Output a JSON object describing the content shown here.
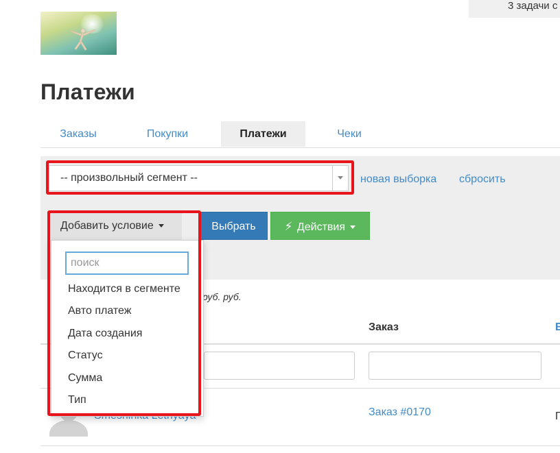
{
  "header": {
    "tasks_text": "3 задачи с"
  },
  "page": {
    "title": "Платежи"
  },
  "tabs": [
    {
      "label": "Заказы",
      "active": false
    },
    {
      "label": "Покупки",
      "active": false
    },
    {
      "label": "Платежи",
      "active": true
    },
    {
      "label": "Чеки",
      "active": false
    }
  ],
  "filter": {
    "segment_value": "-- произвольный сегмент --",
    "new_selection": "новая выборка",
    "reset": "сбросить",
    "add_condition": "Добавить условие",
    "choose": "Выбрать",
    "actions": "Действия"
  },
  "dropdown": {
    "search_placeholder": "поиск",
    "items": [
      "Находится в сегменте",
      "Авто платеж",
      "Дата создания",
      "Статус",
      "Сумма",
      "Тип"
    ]
  },
  "summary": {
    "text": "руб. руб."
  },
  "table": {
    "headers": {
      "order": "Заказ",
      "col_e": "Е"
    },
    "rows": [
      {
        "customer": "Smeshinka Lethyaya",
        "order": "Заказ #0170",
        "status": "П"
      }
    ]
  },
  "colors": {
    "link": "#428bca",
    "primary": "#337ab7",
    "success": "#5cb85c",
    "highlight": "#e8141c"
  }
}
